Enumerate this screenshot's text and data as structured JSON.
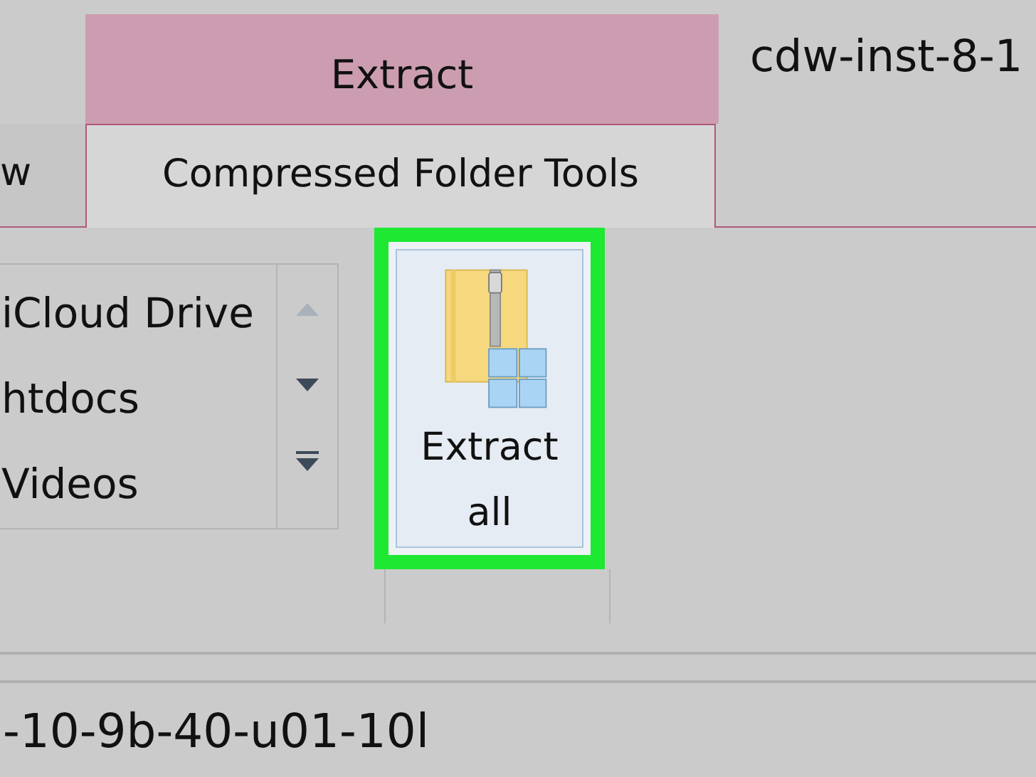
{
  "window": {
    "title": "cdw-inst-8-1"
  },
  "context_tab_group": {
    "label": "Extract"
  },
  "tabs": [
    {
      "label": "w",
      "selected": false
    },
    {
      "label": "Compressed Folder Tools",
      "selected": true
    }
  ],
  "locations_gallery": {
    "items": [
      {
        "label": "iCloud Drive"
      },
      {
        "label": "htdocs"
      },
      {
        "label": "Videos"
      }
    ],
    "buttons": [
      {
        "kind": "up",
        "disabled": true
      },
      {
        "kind": "down",
        "disabled": false
      },
      {
        "kind": "more",
        "disabled": false
      }
    ]
  },
  "extract_all_button": {
    "label": "Extract all",
    "highlighted": true
  },
  "address_bar": {
    "value": "-10-9b-40-u01-10l"
  }
}
